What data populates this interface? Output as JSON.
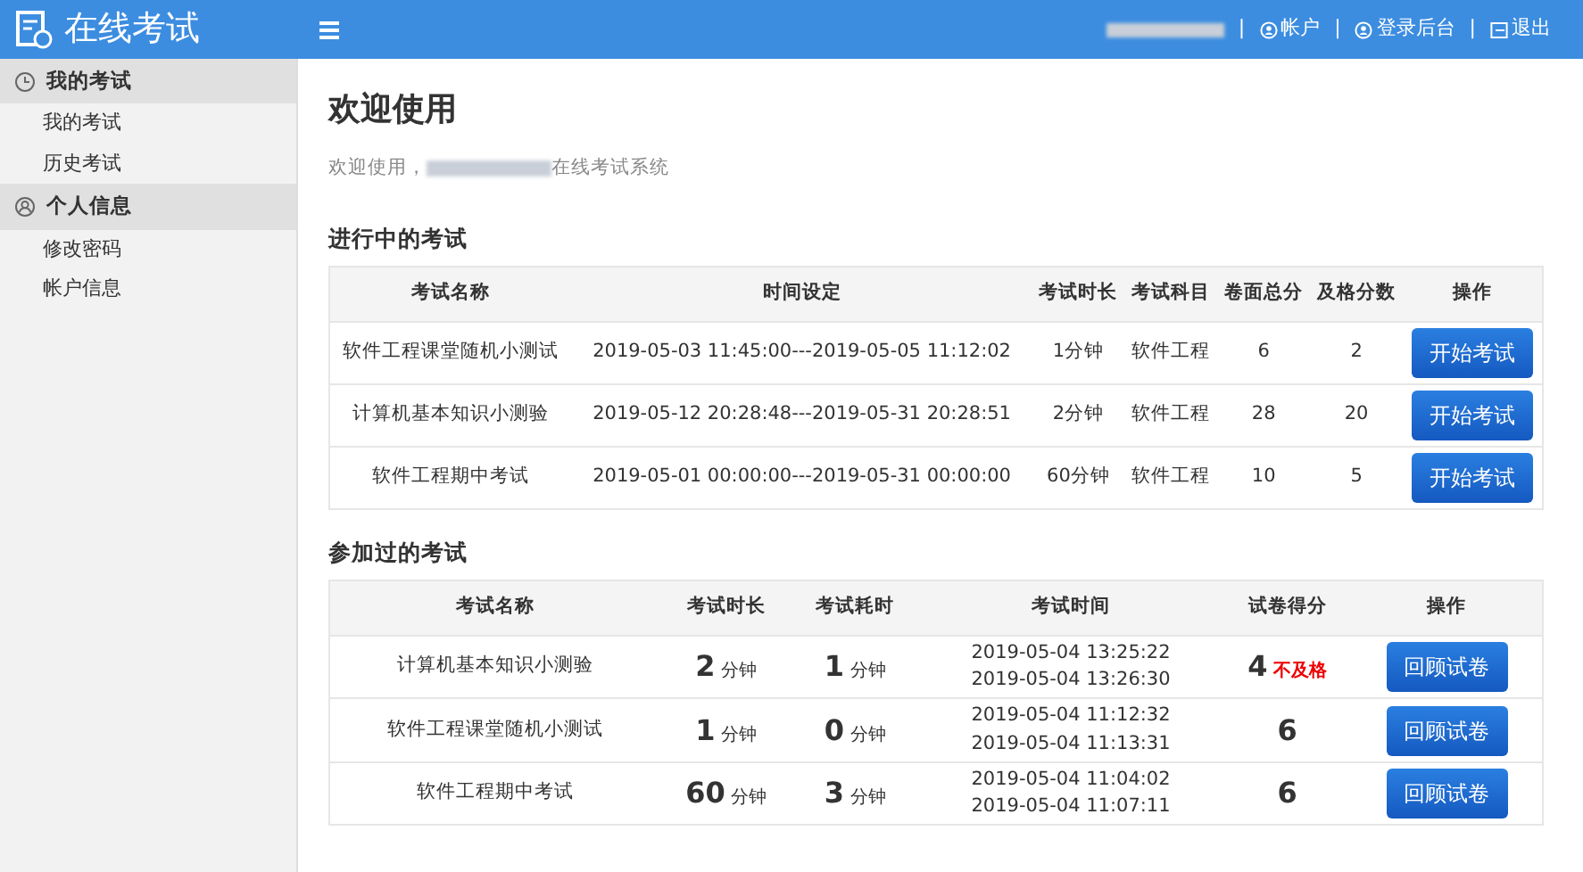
{
  "brand": {
    "title": "在线考试"
  },
  "topbar": {
    "links": [
      {
        "separator": "|",
        "label": "帐户",
        "kind": "account"
      },
      {
        "separator": "|",
        "label": "登录后台",
        "kind": "admin"
      },
      {
        "separator": "|",
        "label": "退出",
        "kind": "logout"
      }
    ]
  },
  "sidebar": {
    "groups": [
      {
        "label": "我的考试",
        "kind": "clock",
        "selected": true,
        "items": [
          {
            "label": "我的考试",
            "selected": false
          },
          {
            "label": "历史考试",
            "selected": false
          }
        ]
      },
      {
        "label": "个人信息",
        "kind": "user",
        "selected": true,
        "items": [
          {
            "label": "修改密码",
            "selected": false
          },
          {
            "label": "帐户信息",
            "selected": false
          }
        ]
      }
    ]
  },
  "page": {
    "title": "欢迎使用",
    "welcome_prefix": "欢迎使用，",
    "welcome_suffix": "在线考试系统"
  },
  "ongoing": {
    "title": "进行中的考试",
    "columns": [
      "考试名称",
      "时间设定",
      "考试时长",
      "考试科目",
      "卷面总分",
      "及格分数",
      "操作"
    ],
    "rows": [
      {
        "name": "软件工程课堂随机小测试",
        "time": "2019-05-03 11:45:00---2019-05-05 11:12:02",
        "duration": "1分钟",
        "subject": "软件工程",
        "total": "6",
        "pass": "2",
        "action": "开始考试"
      },
      {
        "name": "计算机基本知识小测验",
        "time": "2019-05-12 20:28:48---2019-05-31 20:28:51",
        "duration": "2分钟",
        "subject": "软件工程",
        "total": "28",
        "pass": "20",
        "action": "开始考试"
      },
      {
        "name": "软件工程期中考试",
        "time": "2019-05-01 00:00:00---2019-05-31 00:00:00",
        "duration": "60分钟",
        "subject": "软件工程",
        "total": "10",
        "pass": "5",
        "action": "开始考试"
      }
    ]
  },
  "history": {
    "title": "参加过的考试",
    "columns": [
      "考试名称",
      "考试时长",
      "考试耗时",
      "考试时间",
      "试卷得分",
      "操作"
    ],
    "rows": [
      {
        "name": "计算机基本知识小测验",
        "duration": "2",
        "duration_unit": "分钟",
        "used": "1",
        "used_unit": "分钟",
        "start": "2019-05-04 13:25:22",
        "end": "2019-05-04 13:26:30",
        "score": "4",
        "verdict": "不及格",
        "action": "回顾试卷"
      },
      {
        "name": "软件工程课堂随机小测试",
        "duration": "1",
        "duration_unit": "分钟",
        "used": "0",
        "used_unit": "分钟",
        "start": "2019-05-04 11:12:32",
        "end": "2019-05-04 11:13:31",
        "score": "6",
        "action": "回顾试卷"
      },
      {
        "name": "软件工程期中考试",
        "duration": "60",
        "duration_unit": "分钟",
        "used": "3",
        "used_unit": "分钟",
        "start": "2019-05-04 11:04:02",
        "end": "2019-05-04 11:07:11",
        "score": "6",
        "action": "回顾试卷"
      }
    ]
  }
}
